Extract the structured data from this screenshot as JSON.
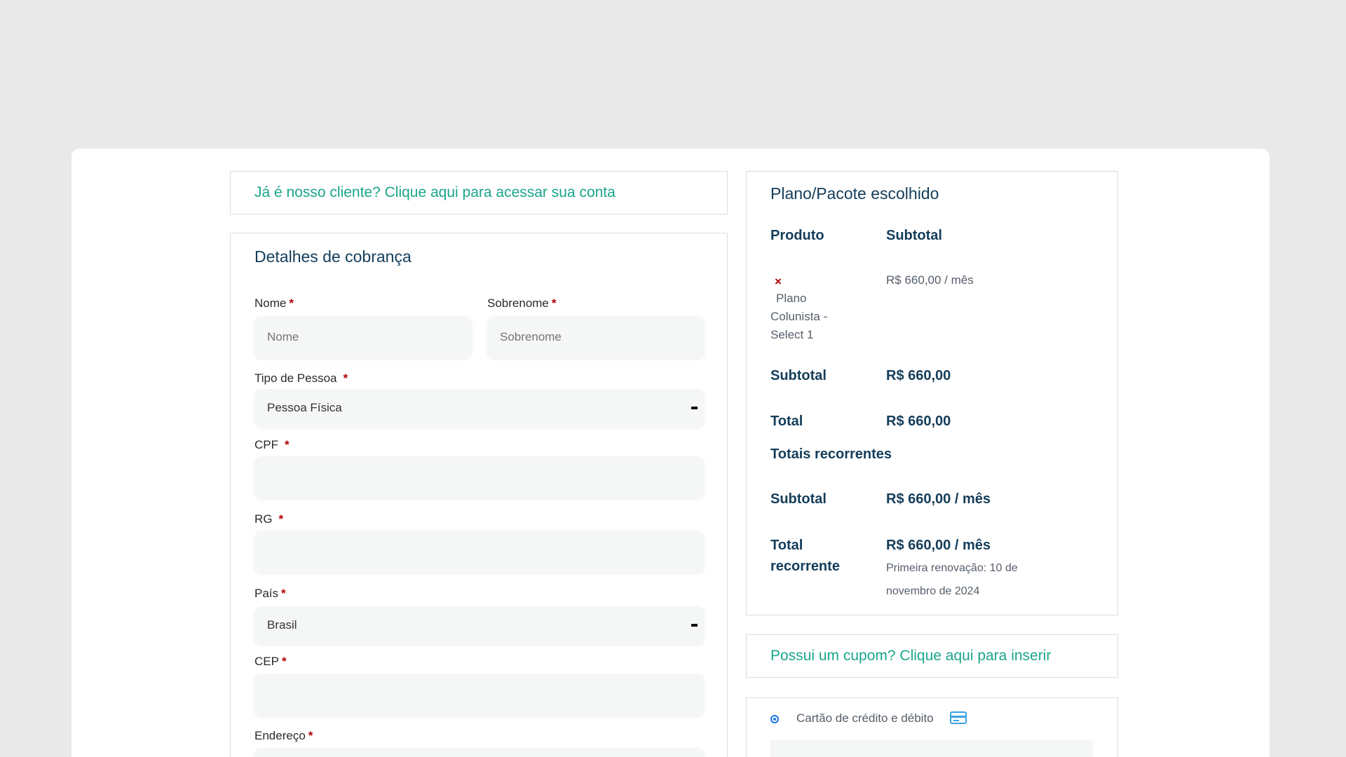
{
  "login_prompt": "Já é nosso cliente? Clique aqui para acessar sua conta",
  "billing": {
    "title": "Detalhes de cobrança",
    "required_mark": "*",
    "nome": {
      "label": "Nome",
      "placeholder": "Nome"
    },
    "sobrenome": {
      "label": "Sobrenome",
      "placeholder": "Sobrenome"
    },
    "tipo_pessoa": {
      "label": "Tipo de Pessoa",
      "value": "Pessoa Física"
    },
    "cpf": {
      "label": "CPF"
    },
    "rg": {
      "label": "RG"
    },
    "pais": {
      "label": "País",
      "value": "Brasil"
    },
    "cep": {
      "label": "CEP"
    },
    "endereco": {
      "label": "Endereço"
    }
  },
  "order": {
    "title": "Plano/Pacote escolhido",
    "col_product": "Produto",
    "col_subtotal": "Subtotal",
    "item": {
      "remove_symbol": "×",
      "name_line1": "Plano",
      "name_line2": "Colunista -",
      "name_line3": "Select 1",
      "price": "R$ 660,00 / mês"
    },
    "subtotal_label": "Subtotal",
    "subtotal_value": "R$ 660,00",
    "total_label": "Total",
    "total_value": "R$ 660,00",
    "recurring_title": "Totais recorrentes",
    "recurring_subtotal_label": "Subtotal",
    "recurring_subtotal_value": "R$ 660,00 / mês",
    "recurring_total_label_line1": "Total",
    "recurring_total_label_line2": "recorrente",
    "recurring_total_amount": "R$ 660,00",
    "recurring_total_suffix": " / mês",
    "renewal_line1": "Primeira renovação: 10 de",
    "renewal_line2": "novembro de 2024"
  },
  "coupon_prompt": "Possui um cupom? Clique aqui para inserir",
  "payment": {
    "method_label": "Cartão de crédito e débito",
    "icon": "credit-card-icon",
    "accent_color": "#1a73e8"
  },
  "colors": {
    "link": "#1aa58a",
    "heading": "#143d5a",
    "required": "#b00000",
    "background": "#e9e9e9"
  }
}
